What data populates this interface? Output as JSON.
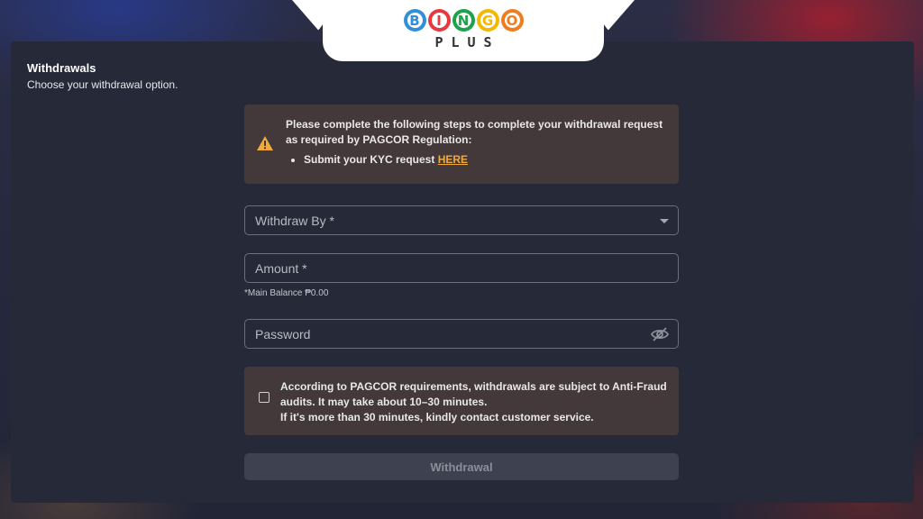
{
  "brand": {
    "letters": [
      {
        "char": "B",
        "color": "#2f8fd8"
      },
      {
        "char": "I",
        "color": "#e8373d"
      },
      {
        "char": "N",
        "color": "#1aa34a"
      },
      {
        "char": "G",
        "color": "#f5b800"
      },
      {
        "char": "O",
        "color": "#f27b1c"
      }
    ],
    "sub": "PLUS"
  },
  "header": {
    "title": "Withdrawals",
    "subtitle": "Choose your withdrawal option."
  },
  "notice": {
    "icon": "warning-icon",
    "line1": "Please complete the following steps to complete your withdrawal request",
    "line2": "as required by PAGCOR Regulation:",
    "item_text": "Submit your KYC request ",
    "item_link": "HERE"
  },
  "form": {
    "withdraw_by_label": "Withdraw By *",
    "amount_label": "Amount *",
    "balance_hint": "*Main Balance ₱0.00",
    "password_label": "Password",
    "password_icon": "eye-slash-icon"
  },
  "fraud_notice": {
    "checked": false,
    "line1": "According to PAGCOR requirements, withdrawals are subject to Anti-Fraud",
    "line2": "audits. It may take about 10–30 minutes.",
    "line3": "If it's more than 30 minutes, kindly contact customer service."
  },
  "submit_label": "Withdrawal",
  "colors": {
    "panel": "#262937",
    "notice_bg": "#43393a",
    "link": "#f2a93b",
    "warning": "#f2a93b",
    "button_disabled": "#3e4150"
  }
}
